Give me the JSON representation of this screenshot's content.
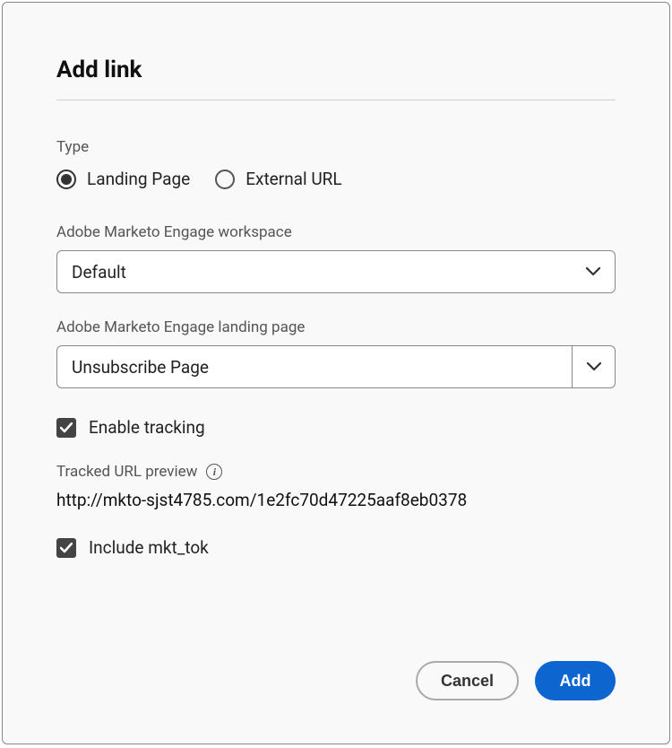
{
  "dialog": {
    "title": "Add link",
    "type_label": "Type",
    "radios": {
      "landing_page": "Landing Page",
      "external_url": "External URL"
    },
    "workspace": {
      "label": "Adobe Marketo Engage workspace",
      "value": "Default"
    },
    "landing_page": {
      "label": "Adobe Marketo Engage landing page",
      "value": "Unsubscribe Page"
    },
    "enable_tracking": "Enable tracking",
    "tracked_url_label": "Tracked URL preview",
    "tracked_url_value": "http://mkto-sjst4785.com/1e2fc70d47225aaf8eb0378",
    "include_mkt_tok": "Include mkt_tok",
    "buttons": {
      "cancel": "Cancel",
      "add": "Add"
    }
  }
}
